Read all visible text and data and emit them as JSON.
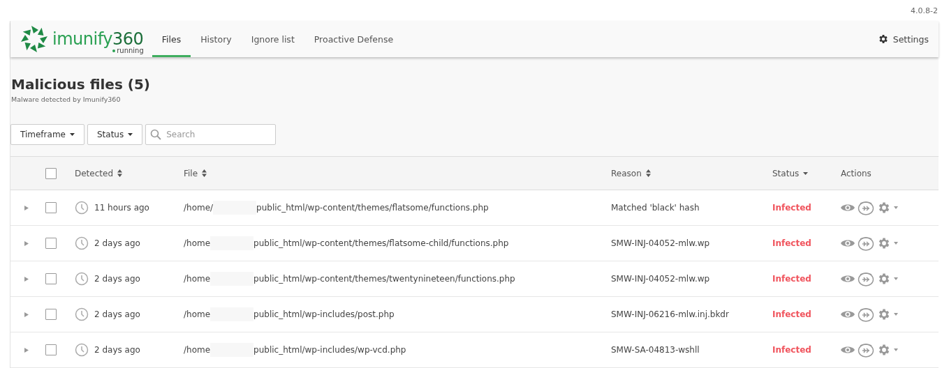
{
  "version": "4.0.8-2",
  "header": {
    "brand": {
      "name": "imunify",
      "number": "360",
      "state": "running"
    },
    "tabs": [
      {
        "label": "Files",
        "selected": true
      },
      {
        "label": "History",
        "selected": false
      },
      {
        "label": "Ignore list",
        "selected": false
      },
      {
        "label": "Proactive Defense",
        "selected": false
      }
    ],
    "settings": "Settings"
  },
  "title": "Malicious files (5)",
  "subtitle": "Malware detected by Imunify360",
  "filters": {
    "buttons": [
      "Timeframe",
      "Status"
    ],
    "search": {
      "placeholder": "Search"
    }
  },
  "table": {
    "select_all": {
      "checked": false
    },
    "columns": [
      {
        "label": "Detected",
        "kind": "sortable"
      },
      {
        "label": "File",
        "kind": "sortable"
      },
      {
        "label": "Reason",
        "kind": "sortable"
      },
      {
        "label": "Status",
        "kind": "sorted"
      },
      {
        "label": "Actions",
        "kind": "plain"
      }
    ],
    "rows": [
      {
        "detected": "11 hours ago",
        "file_prefix": "/home/",
        "file_suffix": "public_html/wp-content/themes/flatsome/functions.php",
        "reason": "Matched 'black' hash",
        "status": "Infected",
        "checked": false,
        "expanded": false
      },
      {
        "detected": "2 days ago",
        "file_prefix": "/home",
        "file_suffix": "public_html/wp-content/themes/flatsome-child/functions.php",
        "reason": "SMW-INJ-04052-mlw.wp",
        "status": "Infected",
        "checked": false,
        "expanded": false
      },
      {
        "detected": "2 days ago",
        "file_prefix": "/home",
        "file_suffix": "public_html/wp-content/themes/twentynineteen/functions.php",
        "reason": "SMW-INJ-04052-mlw.wp",
        "status": "Infected",
        "checked": false,
        "expanded": false
      },
      {
        "detected": "2 days ago",
        "file_prefix": "/home",
        "file_suffix": "public_html/wp-includes/post.php",
        "reason": "SMW-INJ-06216-mlw.inj.bkdr",
        "status": "Infected",
        "checked": false,
        "expanded": false
      },
      {
        "detected": "2 days ago",
        "file_prefix": "/home",
        "file_suffix": "public_html/wp-includes/wp-vcd.php",
        "reason": "SMW-SA-04813-wshll",
        "status": "Infected",
        "checked": false,
        "expanded": false
      }
    ]
  }
}
